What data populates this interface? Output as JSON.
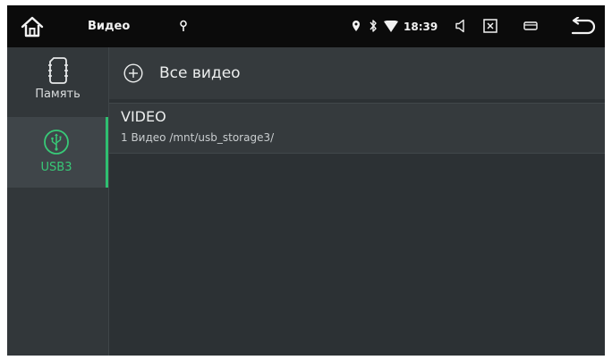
{
  "status_bar": {
    "app_title": "Видео",
    "time": "18:39",
    "icons": [
      "home-icon",
      "location-small-icon",
      "location-icon",
      "bluetooth-icon",
      "wifi-icon",
      "volume-icon",
      "screenshot-icon",
      "window-icon",
      "back-icon"
    ]
  },
  "sidebar": {
    "items": [
      {
        "label": "Память",
        "icon": "memory-card-icon",
        "selected": false
      },
      {
        "label": "USB3",
        "icon": "usb-icon",
        "selected": true
      }
    ]
  },
  "main": {
    "all_videos_label": "Все видео",
    "folders": [
      {
        "name": "VIDEO",
        "info": "1 Видео /mnt/usb_storage3/"
      }
    ]
  },
  "colors": {
    "accent": "#38c977",
    "status_bar_bg": "#0b0b0b",
    "background": "#2c3134"
  }
}
